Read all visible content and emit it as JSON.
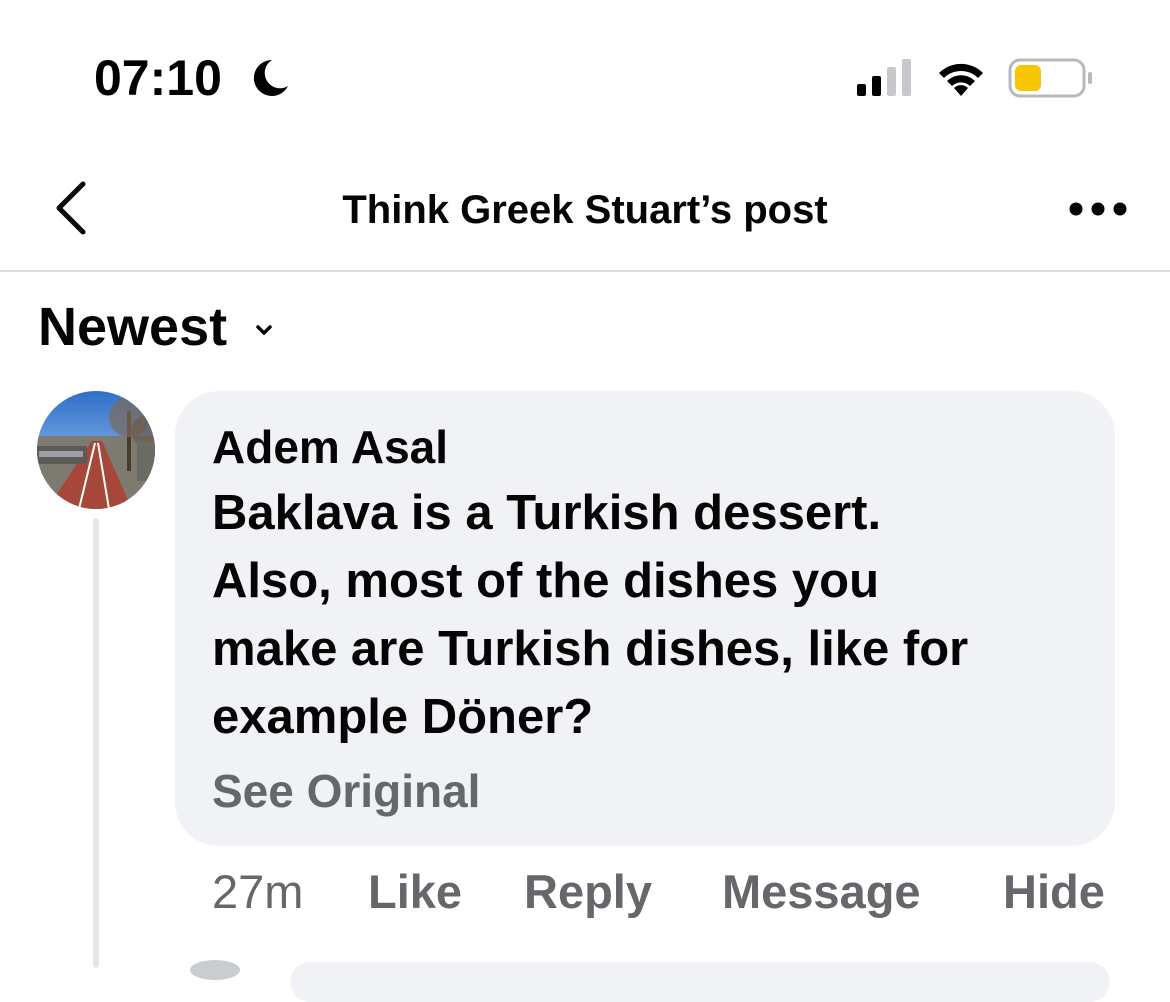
{
  "status_bar": {
    "time": "07:10",
    "icons": [
      "moon-icon",
      "signal-icon",
      "wifi-icon",
      "battery-icon"
    ],
    "battery_color": "#f7c600"
  },
  "header": {
    "title": "Think Greek Stuart’s post",
    "back_icon": "chevron-left-icon",
    "more_icon": "more-dots-icon"
  },
  "sort": {
    "label": "Newest",
    "icon": "chevron-down-icon"
  },
  "comment": {
    "author": "Adem Asal",
    "text": "Baklava is a Turkish dessert.\nAlso, most of the dishes you\nmake are Turkish dishes, like for\nexample Döner?",
    "see_original": "See Original",
    "time": "27m",
    "actions": {
      "like": "Like",
      "reply": "Reply",
      "message": "Message",
      "hide": "Hide"
    }
  },
  "colors": {
    "bubble_bg": "#f0f2f5",
    "secondary_text": "#65676b",
    "primary_text": "#050505",
    "divider": "#dadde1"
  }
}
